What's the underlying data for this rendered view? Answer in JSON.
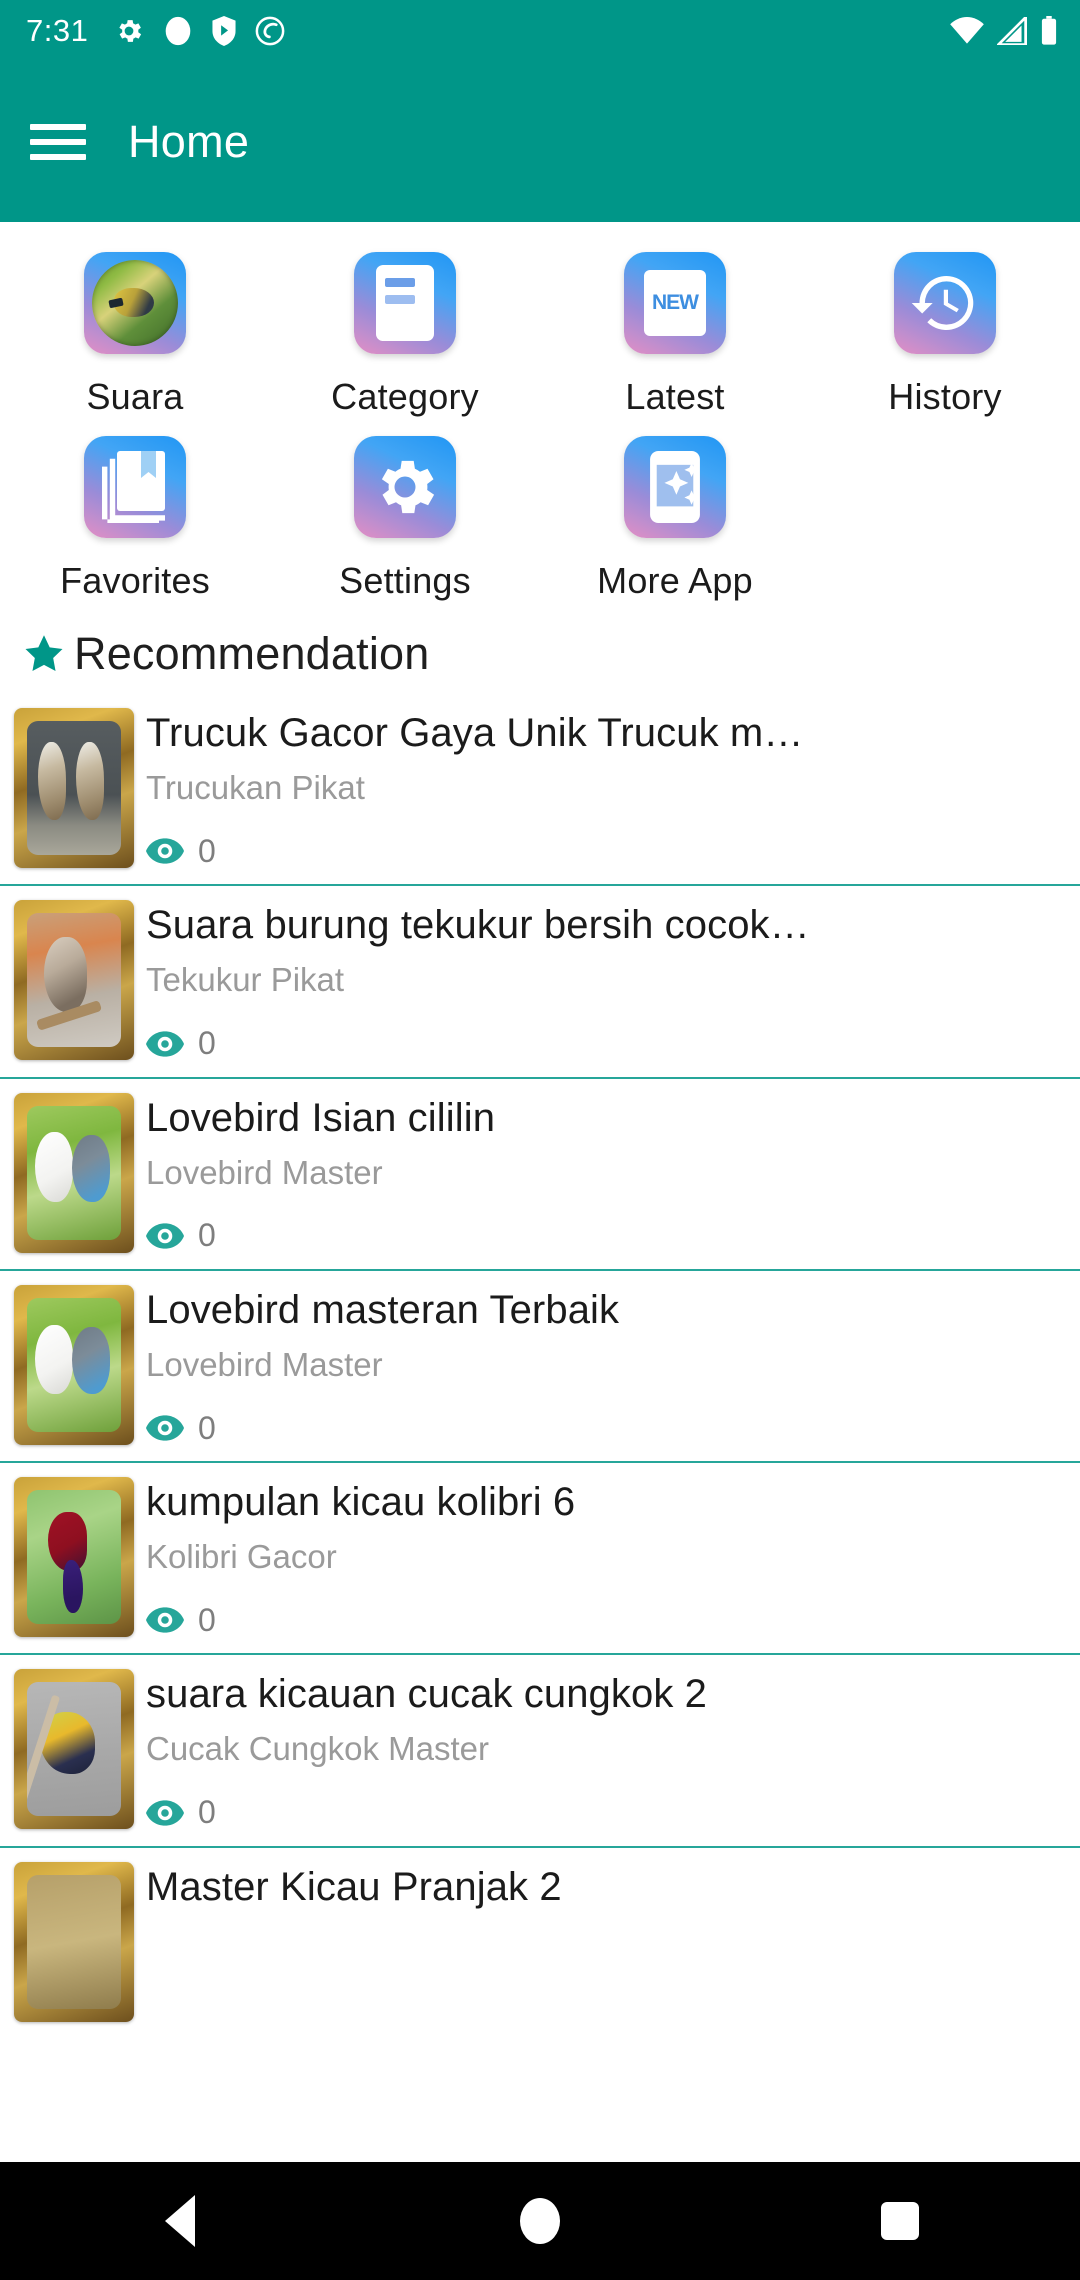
{
  "status_bar": {
    "time": "7:31",
    "left_icons": [
      "gear-icon",
      "circle-icon",
      "play-protect-icon",
      "spiral-icon"
    ],
    "right_icons": [
      "wifi-icon",
      "signal-icon",
      "battery-icon"
    ]
  },
  "app_bar": {
    "menu_icon": "hamburger-menu-icon",
    "title": "Home",
    "background_color": "#009688"
  },
  "grid": {
    "rows": [
      [
        {
          "label": "Suara",
          "icon": "bird-photo-icon"
        },
        {
          "label": "Category",
          "icon": "category-card-icon"
        },
        {
          "label": "Latest",
          "icon": "new-badge-icon"
        },
        {
          "label": "History",
          "icon": "history-clock-icon"
        }
      ],
      [
        {
          "label": "Favorites",
          "icon": "bookmark-book-icon"
        },
        {
          "label": "Settings",
          "icon": "gear-icon"
        },
        {
          "label": "More App",
          "icon": "phone-sparkle-icon"
        }
      ]
    ]
  },
  "section": {
    "icon": "star-icon",
    "title": "Recommendation",
    "accent_color": "#009688"
  },
  "list": {
    "items": [
      {
        "title": "Trucuk Gacor Gaya Unik   Trucuk m…",
        "subtitle": "Trucukan Pikat",
        "views": "0",
        "art": "art-trucuk"
      },
      {
        "title": "Suara burung tekukur bersih cocok…",
        "subtitle": "Tekukur Pikat",
        "views": "0",
        "art": "art-tekukur"
      },
      {
        "title": "Lovebird Isian cililin",
        "subtitle": "Lovebird Master",
        "views": "0",
        "art": "art-lovebird"
      },
      {
        "title": "Lovebird masteran Terbaik",
        "subtitle": "Lovebird Master",
        "views": "0",
        "art": "art-lovebird"
      },
      {
        "title": "kumpulan kicau kolibri 6",
        "subtitle": "Kolibri Gacor",
        "views": "0",
        "art": "art-kolibri"
      },
      {
        "title": "suara kicauan cucak cungkok 2",
        "subtitle": "Cucak Cungkok Master",
        "views": "0",
        "art": "art-cucak"
      },
      {
        "title": "Master Kicau Pranjak 2",
        "subtitle": "",
        "views": "",
        "art": "art-pranjak"
      }
    ]
  },
  "nav_bar": {
    "buttons": [
      {
        "name": "back-button",
        "icon": "triangle-back-icon"
      },
      {
        "name": "home-button",
        "icon": "circle-home-icon"
      },
      {
        "name": "recents-button",
        "icon": "square-recents-icon"
      }
    ]
  }
}
